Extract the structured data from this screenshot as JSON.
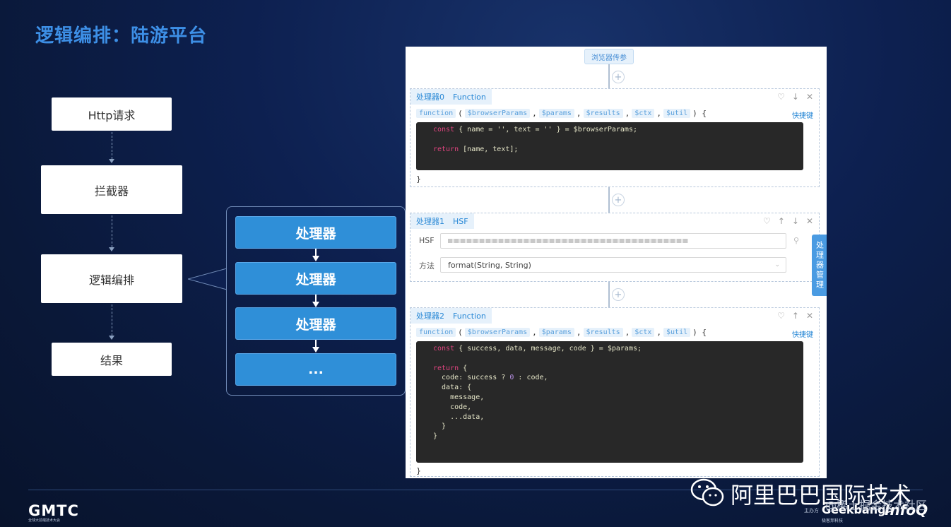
{
  "title": "逻辑编排：陆游平台",
  "flow": {
    "steps": [
      "Http请求",
      "拦截器",
      "逻辑编排",
      "结果"
    ]
  },
  "processors": {
    "items": [
      "处理器",
      "处理器",
      "处理器",
      "..."
    ]
  },
  "editor": {
    "entry_label": "浏览器传参",
    "cards": [
      {
        "name": "处理器0",
        "type": "Function",
        "icons": [
          "heart-icon",
          "arrow-down-icon",
          "close-icon"
        ]
      },
      {
        "name": "处理器1",
        "type": "HSF",
        "icons": [
          "heart-icon",
          "arrow-up-icon",
          "arrow-down-icon",
          "close-icon"
        ]
      },
      {
        "name": "处理器2",
        "type": "Function",
        "icons": [
          "heart-icon",
          "arrow-up-icon",
          "close-icon"
        ]
      }
    ],
    "signature": {
      "keyword": "function",
      "open": "(",
      "params": [
        "$browserParams",
        "$params",
        "$results",
        "$ctx",
        "$util"
      ],
      "close": ") {",
      "end": "}"
    },
    "shortcut": "快捷键",
    "code0": {
      "line1": {
        "kw": "const",
        "rest": " { name = '', text = '' } = $browserParams;"
      },
      "line2": {
        "kw": "return",
        "rest": " [name, text];"
      }
    },
    "hsf": {
      "label": "HSF",
      "value": "",
      "method_label": "方法",
      "method_value": "format(String, String)"
    },
    "code2": {
      "l1_kw": "const",
      "l1": " { success, data, message, code } = $params;",
      "l2_kw": "return",
      "l2": " {",
      "l3": "  code: success ? ",
      "l3_num": "0",
      "l3b": " : code,",
      "l4": "  data: {",
      "l5": "    message,",
      "l6": "    code,",
      "l7": "    ...data,",
      "l8": "  }",
      "l9": "}"
    },
    "side_tab": "处理器管理"
  },
  "footer": {
    "conf": "GMTC",
    "conf_sub": "全球大前端技术大会",
    "brand": "阿里巴巴国际技术",
    "host": "主办方",
    "geek": "Geekbang>.",
    "geek_sub": "极客邦科技",
    "infoq": "InfoQ",
    "watermark": "@稀土掘金技术社区"
  }
}
